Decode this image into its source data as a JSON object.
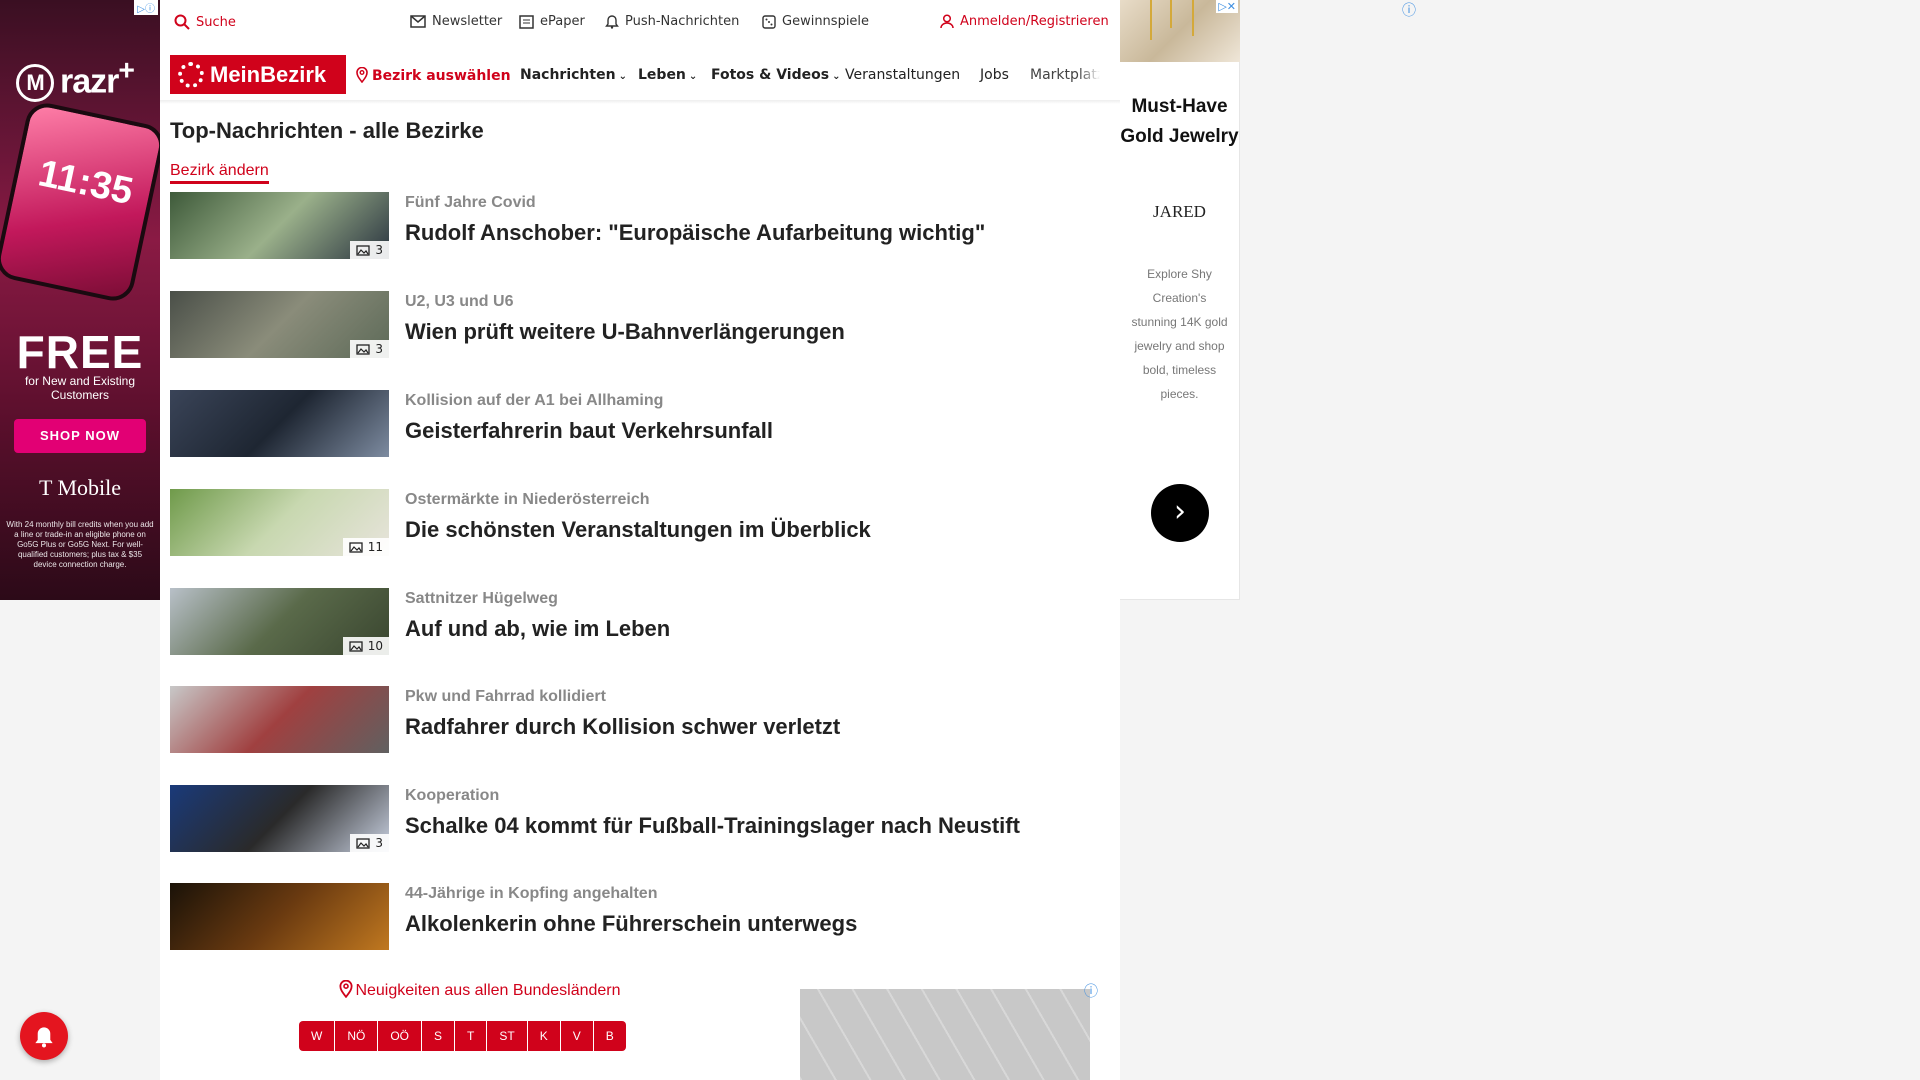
{
  "left_ad": {
    "adchoice": "▷ⓘ",
    "brand": "razr",
    "brand_sup": "+",
    "phone_time": "11:35",
    "headline": "FREE",
    "sub": "for New and Existing Customers",
    "cta": "SHOP NOW",
    "carrier": "T Mobile",
    "fine": "With 24 monthly bill credits when you add a line or trade-in an eligible phone on Go5G Plus or Go5G Next. For well-qualified customers; plus tax & $35 device connection charge."
  },
  "right_ad": {
    "adchoice": "▷✕",
    "title": "Must-Have Gold Jewelry",
    "brand": "JARED",
    "description": "Explore Shy Creation's stunning 14K gold jewelry and shop bold, timeless pieces.",
    "cta_icon": "chevron-right-icon"
  },
  "topbar": {
    "search": "Suche",
    "newsletter": "Newsletter",
    "epaper": "ePaper",
    "push": "Push-Nachrichten",
    "contests": "Gewinnspiele",
    "login": "Anmelden/Registrieren"
  },
  "nav": {
    "logo": "MeinBezirk",
    "select_district": "Bezirk auswählen",
    "news": "Nachrichten",
    "life": "Leben",
    "photos": "Fotos & Videos",
    "events": "Veranstaltungen",
    "jobs": "Jobs",
    "market": "Marktplatz"
  },
  "page": {
    "heading": "Top-Nachrichten - alle Bezirke",
    "change_district": "Bezirk ändern"
  },
  "articles": [
    {
      "kicker": "Fünf Jahre Covid",
      "title": "Rudolf Anschober: \"Europäische Aufarbeitung wichtig\"",
      "photos": "3",
      "colors": [
        "#3e5a3a",
        "#9ab08a",
        "#2a3440"
      ]
    },
    {
      "kicker": "U2, U3 und U6",
      "title": "Wien prüft weitere U-Bahnverlängerungen",
      "photos": "3",
      "colors": [
        "#4a4f48",
        "#8a8c7a",
        "#5d6a58"
      ]
    },
    {
      "kicker": "Kollision auf der A1 bei Allhaming",
      "title": "Geisterfahrerin baut Verkehrsunfall",
      "photos": "",
      "colors": [
        "#3a4458",
        "#1e2632",
        "#7d8ba0"
      ]
    },
    {
      "kicker": "Ostermärkte in Niederösterreich",
      "title": "Die schönsten Veranstaltungen im Überblick",
      "photos": "11",
      "colors": [
        "#6f9a4a",
        "#c8d8b0",
        "#e8e4dc"
      ]
    },
    {
      "kicker": "Sattnitzer Hügelweg",
      "title": "Auf und ab, wie im Leben",
      "photos": "10",
      "colors": [
        "#b8c0c8",
        "#5a6a4a",
        "#39452f"
      ]
    },
    {
      "kicker": "Pkw und Fahrrad kollidiert",
      "title": "Radfahrer durch Kollision schwer verletzt",
      "photos": "",
      "colors": [
        "#c8c8c8",
        "#a04040",
        "#606060"
      ]
    },
    {
      "kicker": "Kooperation",
      "title": "Schalke 04 kommt für Fußball-Trainingslager nach Neustift",
      "photos": "3",
      "colors": [
        "#1a3a7a",
        "#2a2a2a",
        "#c8d0e0"
      ]
    },
    {
      "kicker": "44-Jährige in Kopfing angehalten",
      "title": "Alkolenkerin ohne Führerschein unterwegs",
      "photos": "",
      "colors": [
        "#1a1208",
        "#6a3a10",
        "#c07820"
      ]
    }
  ],
  "bundeslaender": {
    "heading": "Neuigkeiten aus allen Bundesländern",
    "states": [
      "W",
      "NÖ",
      "OÖ",
      "S",
      "T",
      "ST",
      "K",
      "V",
      "B"
    ]
  }
}
